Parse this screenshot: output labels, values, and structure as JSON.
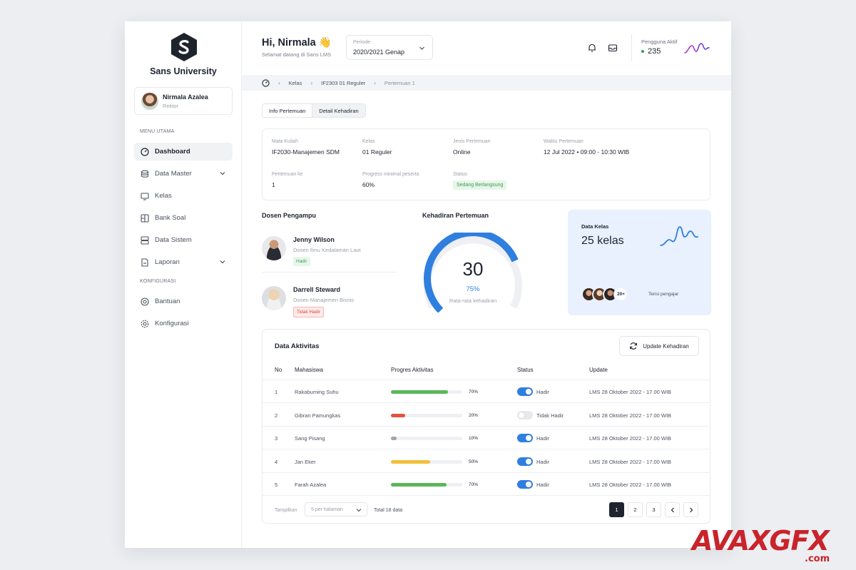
{
  "sidebar": {
    "university": "Sans University",
    "profile": {
      "name": "Nirmala Azalea",
      "role": "Rektor"
    },
    "section_main": "MENU UTAMA",
    "section_config": "KONFIGURASI",
    "items": [
      {
        "label": "Dashboard",
        "icon": "dashboard-icon"
      },
      {
        "label": "Data Master",
        "icon": "database-icon"
      },
      {
        "label": "Kelas",
        "icon": "class-icon"
      },
      {
        "label": "Bank Soal",
        "icon": "bank-icon"
      },
      {
        "label": "Data Sistem",
        "icon": "server-icon"
      },
      {
        "label": "Laporan",
        "icon": "report-icon"
      }
    ],
    "config_items": [
      {
        "label": "Bantuan",
        "icon": "help-icon"
      },
      {
        "label": "Konfigurasi",
        "icon": "gear-icon"
      }
    ]
  },
  "header": {
    "greeting": "Hi, Nirmala 👋",
    "subtitle": "Selamat datang di Sans LMS",
    "periode_label": "Periode",
    "periode_value": "2020/2021 Genap",
    "active_users_label": "Pengguna Aktif",
    "active_users_value": "235"
  },
  "breadcrumb": {
    "items": [
      "Kelas",
      "IF2303 01 Reguler",
      "Pertemuan 1"
    ]
  },
  "tabs": [
    "Info Pertemuan",
    "Detail Kehadiran"
  ],
  "info": {
    "mata_kuliah": {
      "label": "Mata Kuliah",
      "value": "IF2030-Manajemen SDM"
    },
    "kelas": {
      "label": "Kelas",
      "value": "01 Reguler"
    },
    "jenis": {
      "label": "Jenis Pertemuan",
      "value": "Online"
    },
    "waktu": {
      "label": "Waktu Pertemuan",
      "value": "12 Jul 2022 • 09:00 - 10:30 WIB"
    },
    "pertemuan": {
      "label": "Pertemuan ke",
      "value": "1"
    },
    "progress": {
      "label": "Progress minimal peserta",
      "value": "60%"
    },
    "status": {
      "label": "Status",
      "value": "Sedang Berlangsung"
    }
  },
  "dosen": {
    "title": "Dosen Pengampu",
    "list": [
      {
        "name": "Jenny Wilson",
        "role": "Dosen Ilmu Kedalaman Laut",
        "badge": "Hadir"
      },
      {
        "name": "Darrell Steward",
        "role": "Dosen Manajemen Bisnis",
        "badge": "Tidak Hadir"
      }
    ]
  },
  "kehadiran": {
    "title": "Kehadiran Pertemuan",
    "value": "30",
    "percent": "75%",
    "fraction": 0.75,
    "subtitle": "Rata-rata kehadiran"
  },
  "data_kelas": {
    "label": "Data Kelas",
    "value": "25 kelas",
    "more": "20+",
    "caption": "Terisi pengajar"
  },
  "aktivitas": {
    "title": "Data Aktivitas",
    "update_button": "Update Kehadiran",
    "headers": [
      "No",
      "Mahasiswa",
      "Progres Aktivitas",
      "Status",
      "Update"
    ],
    "rows": [
      {
        "no": "1",
        "name": "Rakabuming Suhu",
        "progress": 0.8,
        "pct": "70%",
        "color": "#5bb75a",
        "on": true,
        "status": "Hadir",
        "update": "LMS 28 Oktober 2022 - 17.00 WIB"
      },
      {
        "no": "2",
        "name": "Gibran Pamungkas",
        "progress": 0.2,
        "pct": "20%",
        "color": "#e0533f",
        "on": false,
        "status": "Tidak Hadir",
        "update": "LMS 28 Oktober 2022 - 17.00 WIB"
      },
      {
        "no": "3",
        "name": "Sang Pisang",
        "progress": 0.08,
        "pct": "10%",
        "color": "#a0a4ab",
        "on": true,
        "status": "Hadir",
        "update": "LMS 28 Oktober 2022 - 17.00 WIB"
      },
      {
        "no": "4",
        "name": "Jan Eker",
        "progress": 0.55,
        "pct": "50%",
        "color": "#f2bf3a",
        "on": true,
        "status": "Hadir",
        "update": "LMS 28 Oktober 2022 - 17.00 WIB"
      },
      {
        "no": "5",
        "name": "Farah Azalea",
        "progress": 0.78,
        "pct": "70%",
        "color": "#5bb75a",
        "on": true,
        "status": "Hadir",
        "update": "LMS 28 Oktober 2022 - 17.00 WIB"
      }
    ],
    "footer": {
      "show_label": "Tampilkan",
      "per_page": "5 per halaman",
      "total": "Total 18 data",
      "pages": [
        "1",
        "2",
        "3"
      ]
    }
  },
  "watermark": {
    "text": "AVAXGFX",
    "suffix": ".com"
  }
}
